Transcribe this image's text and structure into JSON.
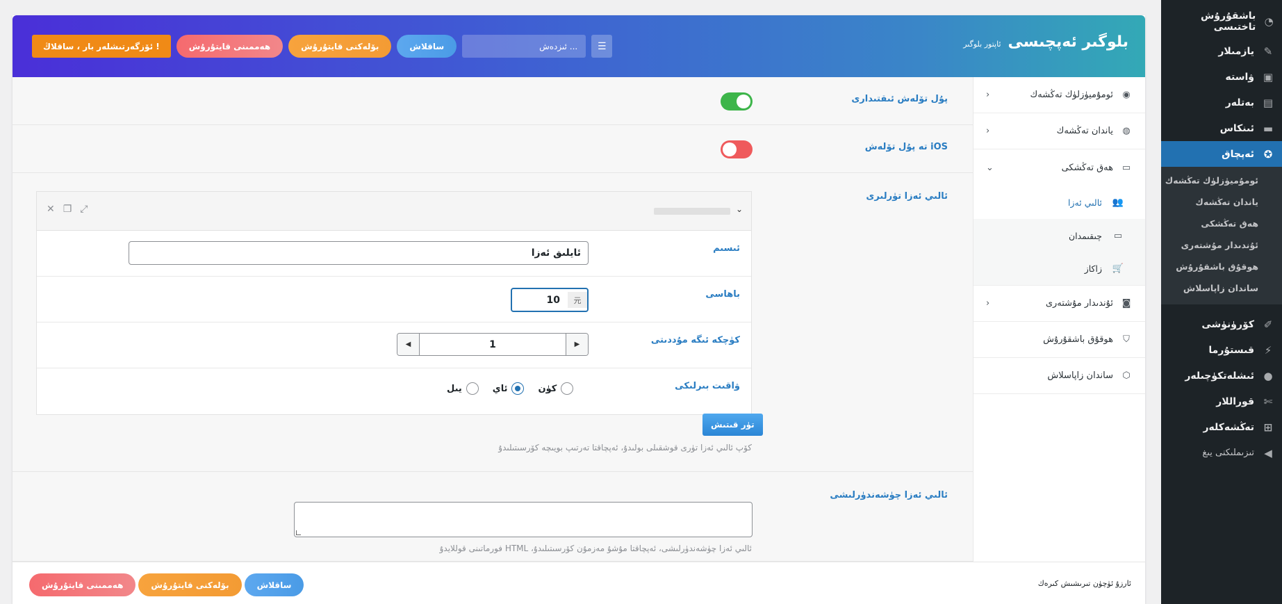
{
  "wp_menu": {
    "items": [
      {
        "label": "باشقۇرۇش تاختىسى",
        "icon": "dashboard-icon"
      },
      {
        "label": "يازمىلار",
        "icon": "pin-icon"
      },
      {
        "label": "ۋاستە",
        "icon": "media-icon"
      },
      {
        "label": "بەتلەر",
        "icon": "pages-icon"
      },
      {
        "label": "ئىنكاس",
        "icon": "comments-icon"
      },
      {
        "label": "ئەپچاق",
        "icon": "accessibility-icon",
        "active": true
      }
    ],
    "sub_items": [
      "ئومۇميۈزلۈك تەڭشەك",
      "ياندان تەڭشەك",
      "ھەق تەڭشكى",
      "ئۇندىدار مۇشتەرى",
      "ھوقۇق باشقۇرۇش",
      "ساندان زاپاسلاش"
    ],
    "lower_items": [
      {
        "label": "كۆرۈنۈشى",
        "icon": "brush-icon"
      },
      {
        "label": "قىستۇرما",
        "icon": "plugin-icon"
      },
      {
        "label": "ئىشلەتكۈچىلەر",
        "icon": "users-icon"
      },
      {
        "label": "قوراللار",
        "icon": "tools-icon"
      },
      {
        "label": "تەڭشەكلەر",
        "icon": "settings-icon"
      },
      {
        "label": "تىزىملىكنى يىغ",
        "icon": "collapse-icon"
      }
    ]
  },
  "header": {
    "title": "بلوگىر ئەپچىسى",
    "subtitle": "ئاپتور بلوگىر",
    "search_placeholder": "ئىزدەش ...",
    "btn_save": "ساقلاش",
    "btn_reset_section": "بۆلەكنى قايتۇرۇش",
    "btn_reset_all": "ھەممىنى قايتۇرۇش",
    "btn_warning": "ئۆزگەرتىشلەر بار ، ساقلاڭ !"
  },
  "plugin_nav": {
    "general": "ئومۇميۈزلۈك تەڭشەك",
    "sidebar": "ياندان تەڭشەك",
    "payment": "ھەق تەڭشكى",
    "payment_sub": [
      {
        "label": "ئالىي ئەزا",
        "icon": "users-group-icon",
        "active": true
      },
      {
        "label": "چىقىمدان",
        "icon": "credit-card-icon"
      },
      {
        "label": "زاكاز",
        "icon": "cart-icon"
      }
    ],
    "wechat": "ئۇندىدار مۇشتەرى",
    "permissions": "ھوقۇق باشقۇرۇش",
    "backup": "ساندان زاپاسلاش"
  },
  "form": {
    "paid_switch_label": "پۇل تۆلەش ئىقتىدارى",
    "paid_switch_on": true,
    "ios_switch_label": "iOS تە پۇل تۆلەش",
    "ios_switch_on": false,
    "vip_types_label": "ئالىي ئەزا تۈرلىرى",
    "name_label": "ئىسىم",
    "name_value": "ئايلىق ئەزا",
    "price_label": "باھاسى",
    "price_value": "10",
    "price_unit": "元",
    "duration_label": "كۈچكە ئىگە مۇددىتى",
    "duration_value": "1",
    "unit_label": "ۋاقىت بىرلىكى",
    "unit_options": [
      {
        "label": "كۈن",
        "selected": false
      },
      {
        "label": "ئاي",
        "selected": true
      },
      {
        "label": "يىل",
        "selected": false
      }
    ],
    "add_button": "تۈر قىتىش",
    "vip_help": "كۆپ ئالىي ئەزا تۈرى قوشقىلى بولىدۇ، ئەپچاقتا تەرتىپ بويىچە كۆرسىتىلىدۇ",
    "desc_label": "ئالىي ئەزا چۈشەندۈرلىشى",
    "desc_help": "ئالىي ئەزا چۈشەندۈرلىشى، ئەپچاقتا مۇشۇ مەزمۇن كۆرسىتىلىدۇ، HTML فورماتىنى قوللايدۇ"
  },
  "footer": {
    "note": "ئارزۇ ئۈچۈن تىرىشىش كىرەك",
    "btn_save": "ساقلاش",
    "btn_reset_section": "بۆلەكنى قايتۇرۇش",
    "btn_reset_all": "ھەممىنى قايتۇرۇش"
  }
}
